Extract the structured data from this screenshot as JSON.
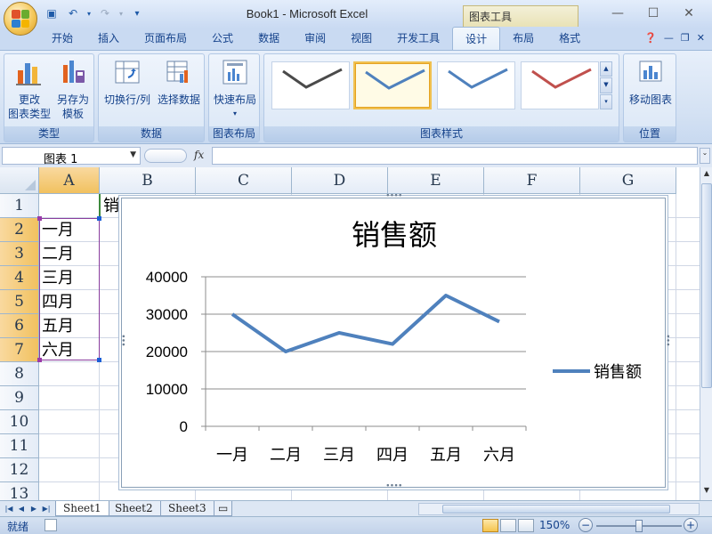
{
  "window": {
    "title": "Book1 - Microsoft Excel",
    "contextual_tab_group": "图表工具",
    "controls": {
      "minimize": "—",
      "maximize": "☐",
      "close": "✕"
    }
  },
  "ribbon": {
    "tabs": [
      {
        "label": "开始"
      },
      {
        "label": "插入"
      },
      {
        "label": "页面布局"
      },
      {
        "label": "公式"
      },
      {
        "label": "数据"
      },
      {
        "label": "审阅"
      },
      {
        "label": "视图"
      },
      {
        "label": "开发工具"
      },
      {
        "label": "设计"
      },
      {
        "label": "布局"
      },
      {
        "label": "格式"
      }
    ],
    "active_tab": "设计",
    "groups": {
      "type": {
        "label": "类型",
        "change_chart_type": "更改\n图表类型",
        "save_as_template": "另存为\n模板"
      },
      "data": {
        "label": "数据",
        "switch_row_col": "切换行/列",
        "select_data": "选择数据"
      },
      "layouts": {
        "label": "图表布局",
        "quick_layout": "快速布局"
      },
      "styles": {
        "label": "图表样式",
        "colors": [
          "#4a4a4a",
          "#4f81bd",
          "#4f81bd",
          "#c0504d"
        ],
        "selected_index": 1
      },
      "location": {
        "label": "位置",
        "move_chart": "移动图表"
      }
    }
  },
  "formula_bar": {
    "name_box": "图表 1",
    "fx": "fx",
    "formula": ""
  },
  "sheet": {
    "columns": [
      "A",
      "B",
      "C",
      "D",
      "E",
      "F",
      "G"
    ],
    "rows": [
      "1",
      "2",
      "3",
      "4",
      "5",
      "6",
      "7",
      "8",
      "9",
      "10",
      "11",
      "12",
      "13"
    ],
    "cells": {
      "B1": "销",
      "A2": "一月",
      "A3": "二月",
      "A4": "三月",
      "A5": "四月",
      "A6": "五月",
      "A7": "六月"
    }
  },
  "chart_data": {
    "type": "line",
    "title": "销售额",
    "categories": [
      "一月",
      "二月",
      "三月",
      "四月",
      "五月",
      "六月"
    ],
    "series": [
      {
        "name": "销售额",
        "values": [
          30000,
          20000,
          25000,
          22000,
          35000,
          28000
        ],
        "color": "#4f81bd"
      }
    ],
    "ylim": [
      0,
      40000
    ],
    "yticks": [
      "40000",
      "30000",
      "20000",
      "10000",
      "0"
    ],
    "grid": true,
    "legend": "right"
  },
  "sheet_tabs": [
    {
      "label": "Sheet1"
    },
    {
      "label": "Sheet2"
    },
    {
      "label": "Sheet3"
    }
  ],
  "status_bar": {
    "ready": "就绪",
    "zoom": "150%"
  }
}
